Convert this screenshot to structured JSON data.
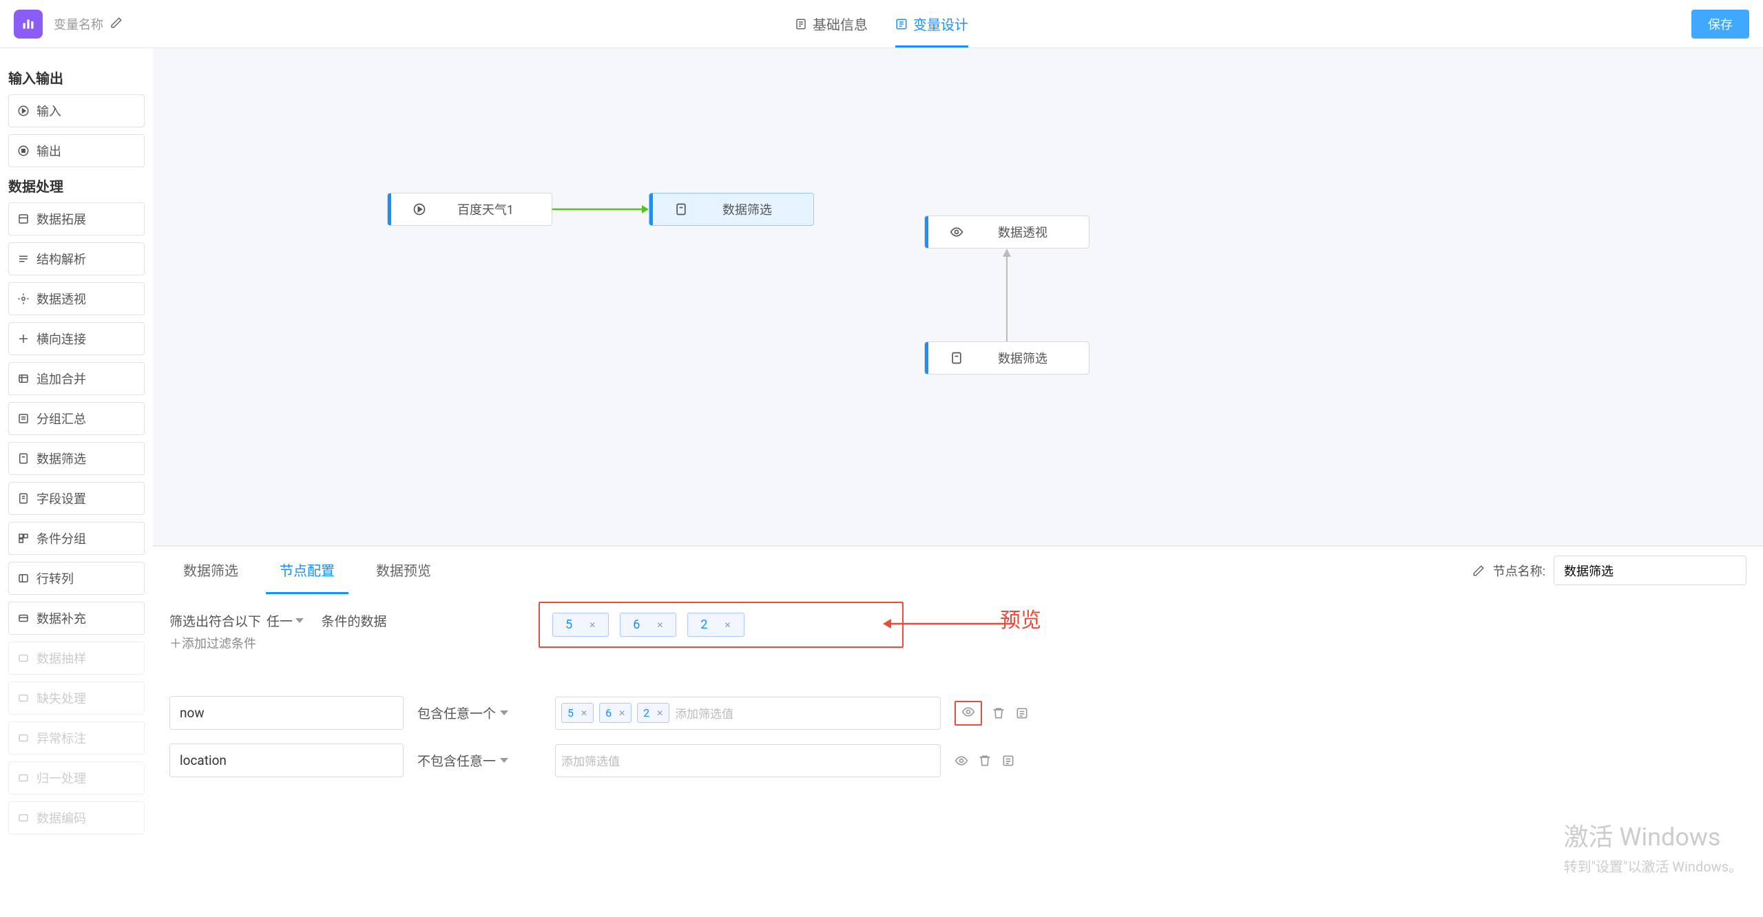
{
  "header": {
    "title": "变量名称",
    "tabs": [
      {
        "label": "基础信息",
        "active": false
      },
      {
        "label": "变量设计",
        "active": true
      }
    ],
    "save": "保存"
  },
  "sidebar": {
    "section1": "输入输出",
    "io": [
      {
        "label": "输入"
      },
      {
        "label": "输出"
      }
    ],
    "section2": "数据处理",
    "processing": [
      {
        "label": "数据拓展"
      },
      {
        "label": "结构解析"
      },
      {
        "label": "数据透视"
      },
      {
        "label": "横向连接"
      },
      {
        "label": "追加合并"
      },
      {
        "label": "分组汇总"
      },
      {
        "label": "数据筛选"
      },
      {
        "label": "字段设置"
      },
      {
        "label": "条件分组"
      },
      {
        "label": "行转列"
      },
      {
        "label": "数据补充"
      }
    ],
    "disabled": [
      {
        "label": "数据抽样"
      },
      {
        "label": "缺失处理"
      },
      {
        "label": "异常标注"
      },
      {
        "label": "归一处理"
      },
      {
        "label": "数据编码"
      }
    ]
  },
  "canvas": {
    "nodes": {
      "n1": "百度天气1",
      "n2": "数据筛选",
      "n3": "数据透视",
      "n4": "数据筛选"
    }
  },
  "panel": {
    "tabs": [
      {
        "label": "数据筛选",
        "active": false
      },
      {
        "label": "节点配置",
        "active": true
      },
      {
        "label": "数据预览",
        "active": false
      }
    ],
    "node_name_label": "节点名称:",
    "node_name_value": "数据筛选",
    "filter_prefix": "筛选出符合以下",
    "filter_mode": "任一",
    "filter_suffix": "条件的数据",
    "add_condition": "＋添加过滤条件",
    "rows": [
      {
        "field": "now",
        "op": "包含任意一个",
        "values": [
          "5",
          "6",
          "2"
        ],
        "placeholder": "添加筛选值"
      },
      {
        "field": "location",
        "op": "不包含任意一",
        "values": [],
        "placeholder": "添加筛选值"
      }
    ],
    "preview_values": [
      "5",
      "6",
      "2"
    ]
  },
  "annotation": {
    "label": "预览"
  },
  "watermark": {
    "title": "激活 Windows",
    "sub": "转到\"设置\"以激活 Windows。"
  }
}
